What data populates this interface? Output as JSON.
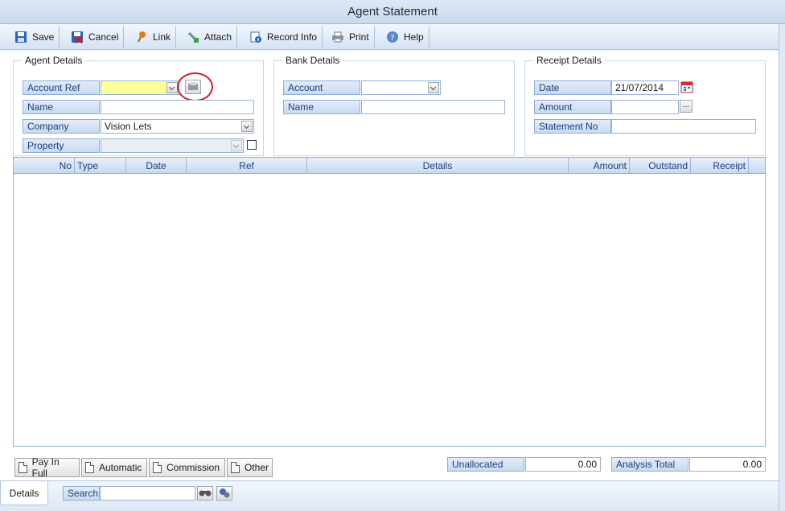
{
  "window": {
    "title": "Agent Statement"
  },
  "toolbar": {
    "save": "Save",
    "cancel": "Cancel",
    "link": "Link",
    "attach": "Attach",
    "record_info": "Record Info",
    "print": "Print",
    "help": "Help"
  },
  "agent_details": {
    "title": "Agent Details",
    "account_ref_label": "Account Ref",
    "account_ref_value": "",
    "name_label": "Name",
    "name_value": "",
    "company_label": "Company",
    "company_value": "Vision Lets",
    "property_label": "Property",
    "property_value": ""
  },
  "bank_details": {
    "title": "Bank Details",
    "account_label": "Account",
    "account_value": "",
    "name_label": "Name",
    "name_value": ""
  },
  "receipt_details": {
    "title": "Receipt Details",
    "date_label": "Date",
    "date_value": "21/07/2014",
    "amount_label": "Amount",
    "amount_value": "",
    "amount_btn": "...",
    "statement_label": "Statement No",
    "statement_value": ""
  },
  "grid": {
    "columns": [
      "No",
      "Type",
      "Date",
      "Ref",
      "Details",
      "Amount",
      "Outstand",
      "Receipt"
    ],
    "rows": []
  },
  "bottom_buttons": {
    "pay_in_full": "Pay In Full",
    "automatic": "Automatic",
    "commission": "Commission",
    "other": "Other"
  },
  "totals": {
    "unallocated_label": "Unallocated",
    "unallocated_value": "0.00",
    "analysis_label": "Analysis Total",
    "analysis_value": "0.00"
  },
  "status": {
    "tab": "Details",
    "search_label": "Search",
    "search_value": ""
  },
  "colors": {
    "accent": "#1c3f78",
    "highlight_field": "#ffff99",
    "annotation": "#d42020"
  }
}
